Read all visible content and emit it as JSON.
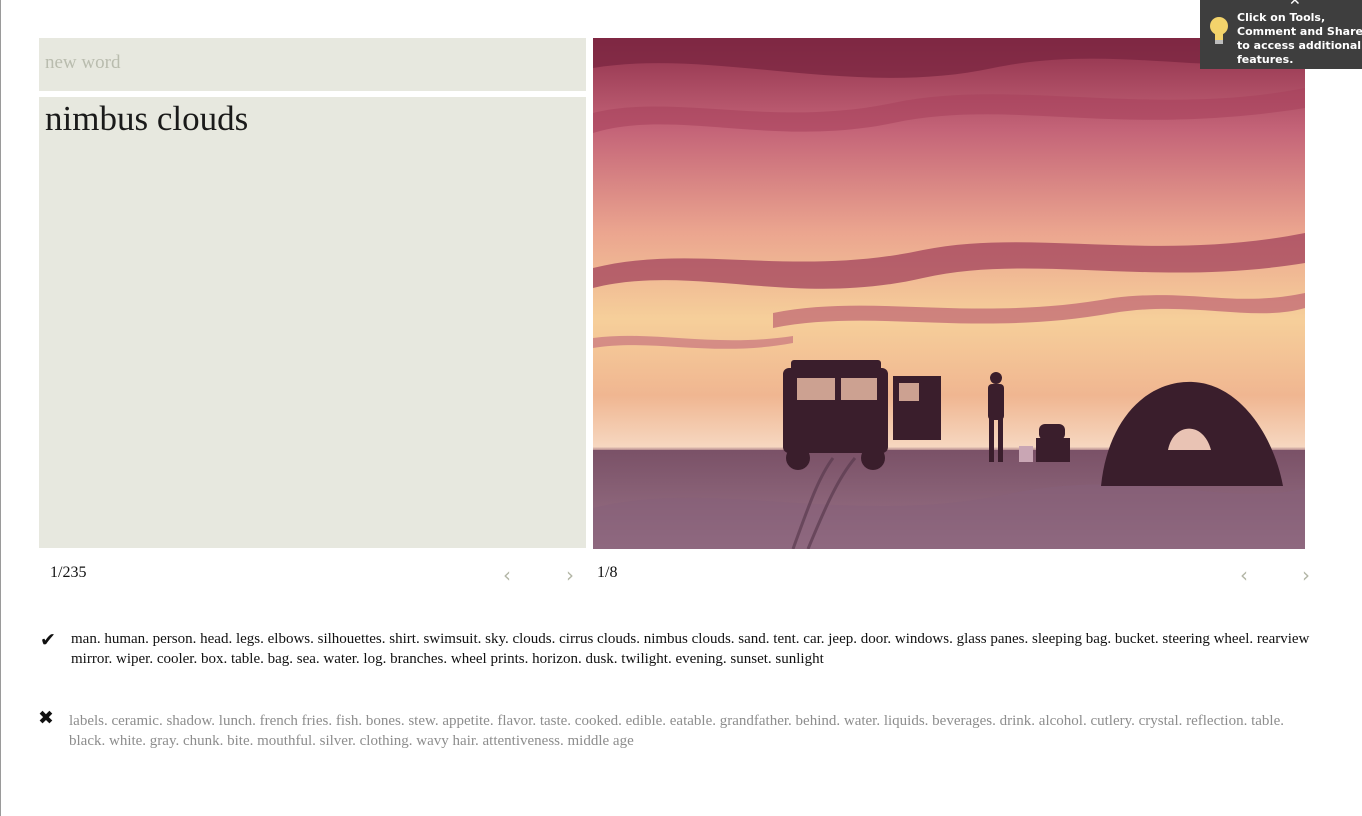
{
  "input": {
    "placeholder": "new word"
  },
  "current_word": "nimbus clouds",
  "word_nav": {
    "counter": "1/235",
    "prev_icon": "chevron-left-icon",
    "next_icon": "chevron-right-icon"
  },
  "image_nav": {
    "counter": "1/8",
    "prev_icon": "chevron-left-icon",
    "next_icon": "chevron-right-icon"
  },
  "correct_tags": {
    "icon": "checkmark-icon",
    "text": "man. human. person. head. legs. elbows. silhouettes. shirt. swimsuit. sky. clouds. cirrus clouds. nimbus clouds. sand. tent. car. jeep. door. windows. glass panes. sleeping bag. bucket. steering wheel. rearview mirror. wiper. cooler. box. table. bag. sea. water. log. branches. wheel prints. horizon. dusk. twilight. evening. sunset. sunlight"
  },
  "incorrect_tags": {
    "icon": "x-mark-icon",
    "text": "labels. ceramic. shadow. lunch. french fries. fish. bones. stew. appetite. flavor. taste. cooked. edible. eatable. grandfather. behind. water. liquids. beverages. drink. alcohol. cutlery. crystal. reflection. table. black. white. gray. chunk. bite. mouthful. silver. clothing. wavy hair. attentiveness. middle age"
  },
  "tooltip": {
    "text": "Click on Tools, Comment and Share to access additional features.",
    "icon": "lightbulb-icon",
    "close_icon": "close-icon"
  },
  "colors": {
    "panel_bg": "#e7e8df",
    "tooltip_bg": "#3e3e3e",
    "muted_text": "#8d8d8d",
    "arrow": "#b3b6a6"
  }
}
